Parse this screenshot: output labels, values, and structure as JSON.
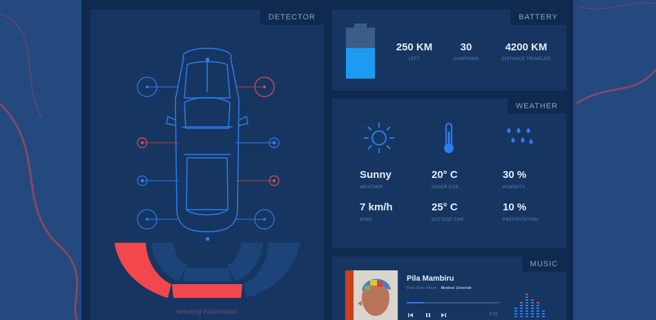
{
  "detector": {
    "title": "DETECTOR",
    "footer": "warning information"
  },
  "battery": {
    "title": "BATTERY",
    "level_percent": 60,
    "stats": [
      {
        "value": "250 KM",
        "label": "LEFT"
      },
      {
        "value": "30",
        "label": "CHARGING"
      },
      {
        "value": "4200 KM",
        "label": "DISTANCE TRAVELED"
      }
    ]
  },
  "weather": {
    "title": "WEATHER",
    "icons": [
      "sun-icon",
      "thermometer-icon",
      "rain-drops-icon"
    ],
    "items": [
      {
        "value": "Sunny",
        "label": "WEATHER"
      },
      {
        "value": "20° C",
        "label": "INSIDE CAR"
      },
      {
        "value": "30 %",
        "label": "HUMIDITY"
      },
      {
        "value": "7 km/h",
        "label": "WIND"
      },
      {
        "value": "25° C",
        "label": "OUTSIDE CAR"
      },
      {
        "value": "10 %",
        "label": "PRECIPITATION"
      }
    ]
  },
  "music": {
    "title": "MUSIC",
    "track": "Pila Mambiru",
    "subtitle": "Dark Deer Album",
    "artist": "Modest Zenerah",
    "progress": 0.18,
    "time": "0:32"
  },
  "colors": {
    "accent_blue": "#2f7df0",
    "warning_red": "#f2474d",
    "panel": "#163661"
  }
}
